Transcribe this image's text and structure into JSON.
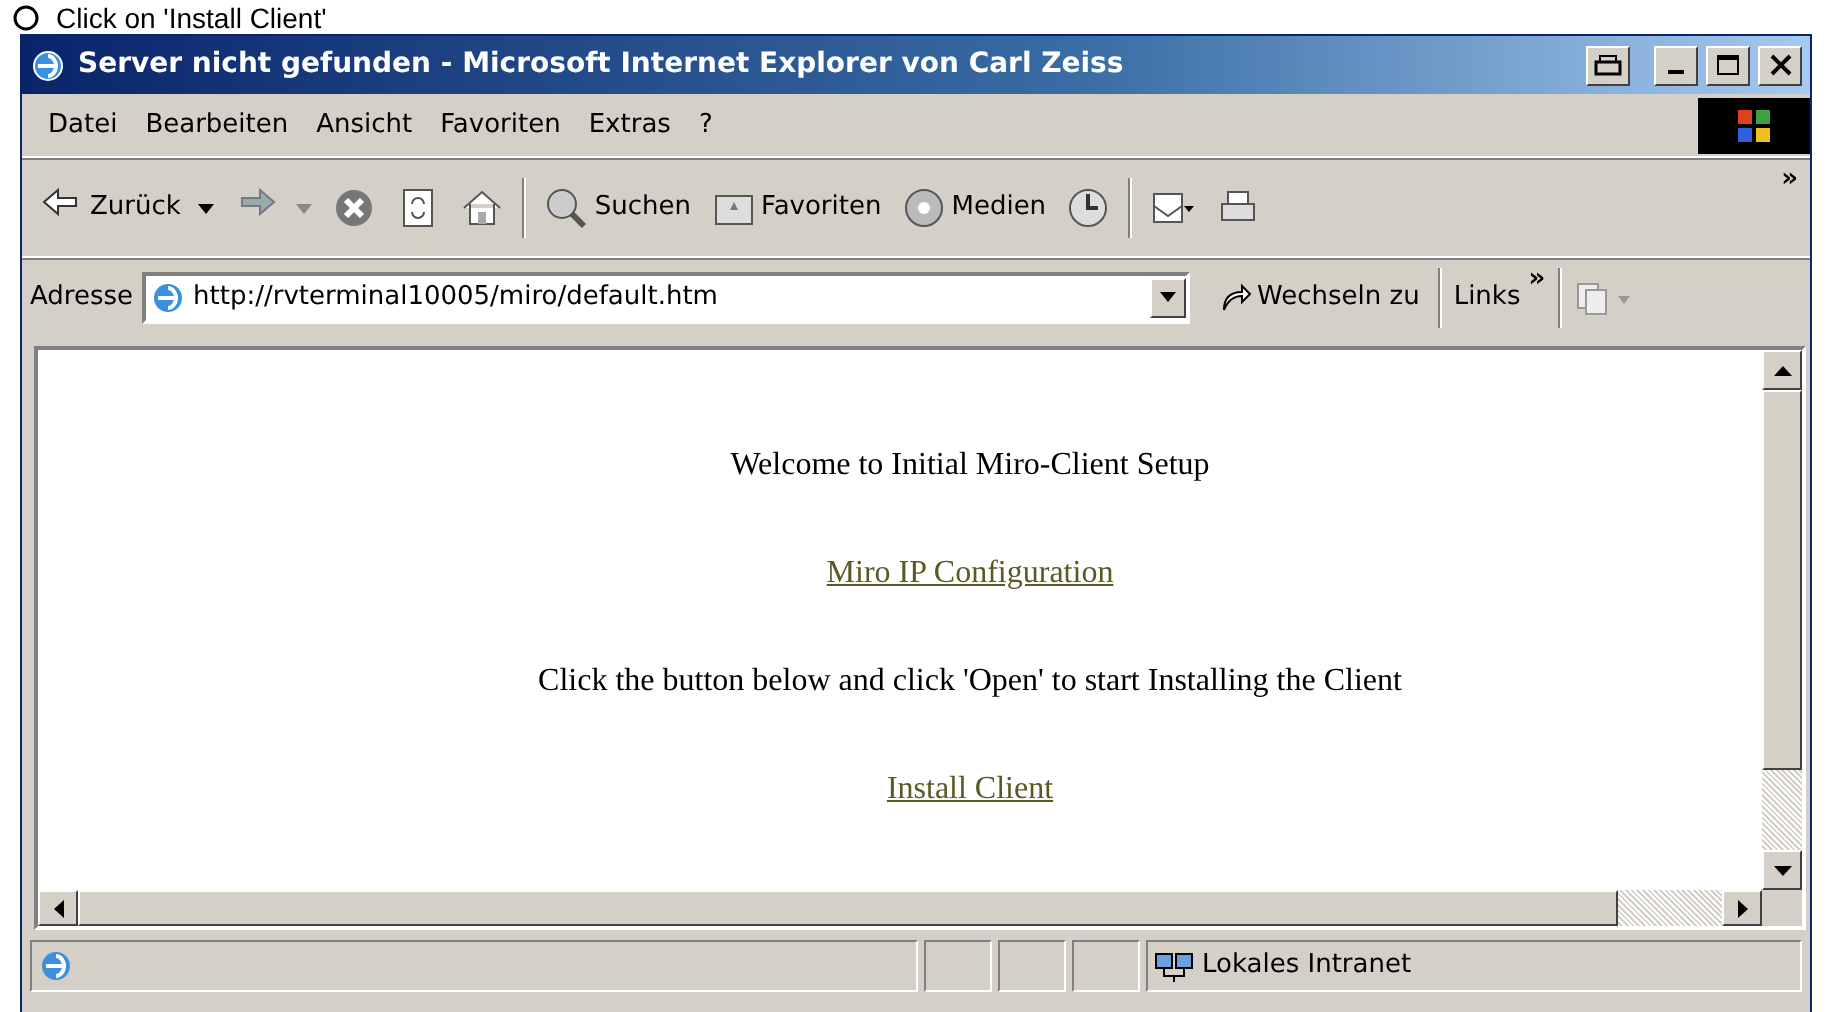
{
  "caption": {
    "text": "Click on 'Install Client'"
  },
  "window": {
    "title": "Server nicht gefunden - Microsoft Internet Explorer von Carl Zeiss"
  },
  "menu": [
    "Datei",
    "Bearbeiten",
    "Ansicht",
    "Favoriten",
    "Extras",
    "?"
  ],
  "toolbar": [
    {
      "kind": "back",
      "label": "Zurück"
    },
    {
      "kind": "forward"
    },
    {
      "kind": "stop"
    },
    {
      "kind": "refresh"
    },
    {
      "kind": "home"
    },
    {
      "kind": "search",
      "label": "Suchen"
    },
    {
      "kind": "favorites",
      "label": "Favoriten"
    },
    {
      "kind": "media",
      "label": "Medien"
    },
    {
      "kind": "history"
    },
    {
      "kind": "mail"
    },
    {
      "kind": "print"
    }
  ],
  "toolbar_more": "»",
  "address": {
    "label": "Adresse",
    "value": "http://rvterminal10005/miro/default.htm",
    "go": "Wechseln zu",
    "links": "Links",
    "links_more": "»"
  },
  "content": [
    {
      "kind": "text",
      "text": "Welcome to Initial Miro-Client Setup"
    },
    {
      "kind": "link",
      "text": "Miro IP Configuration"
    },
    {
      "kind": "text",
      "text": "Click the button below and click 'Open' to start Installing the Client"
    },
    {
      "kind": "link",
      "text": "Install Client"
    }
  ],
  "status_bar": {
    "zone": "Lokales Intranet"
  }
}
